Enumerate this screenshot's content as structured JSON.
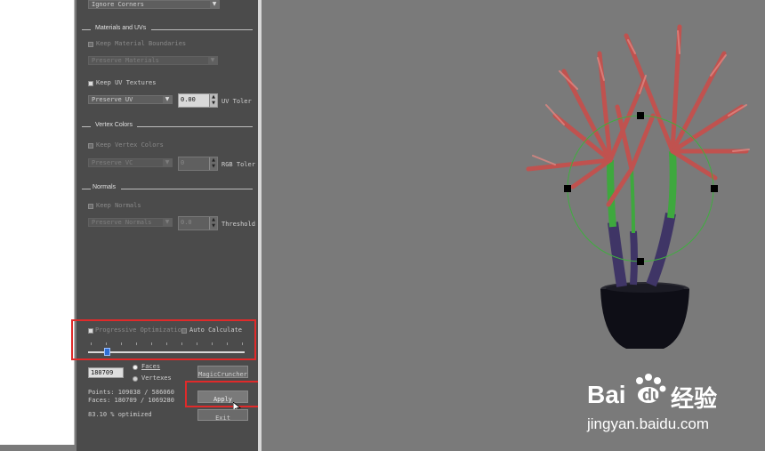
{
  "top": {
    "corners_dropdown": "Ignore Corners"
  },
  "materials": {
    "heading": "Materials and UVs",
    "keep_material_boundaries": "Keep Material Boundaries",
    "preserve_materials": "Preserve Materials",
    "keep_uv_textures": "Keep UV Textures",
    "preserve_uv": "Preserve UV",
    "uv_value": "0.00",
    "uv_tolerance_label": "UV Toler"
  },
  "vertex_colors": {
    "heading": "Vertex Colors",
    "keep_vertex_colors": "Keep Vertex Colors",
    "preserve_vc": "Preserve VC",
    "rgb_value": "0",
    "rgb_tolerance_label": "RGB Toler"
  },
  "normals": {
    "heading": "Normals",
    "keep_normals": "Keep Normals",
    "preserve_normals": "Preserve Normals",
    "threshold_value": "0.0",
    "threshold_label": "Threshold"
  },
  "optimization": {
    "progressive": "Progressive Optimization",
    "auto_calculate": "Auto Calculate",
    "slider_fraction": 0.12,
    "count_value": "180709",
    "faces_label": "Faces",
    "vertexes_label": "Vertexes",
    "magic_button": "MagicCruncher",
    "points_line": "Points: 109038 / 586060",
    "faces_line": "Faces: 180709 / 1069280",
    "optimized": "83.10 % optimized",
    "apply": "Apply",
    "exit": "Exit"
  },
  "watermark": {
    "brand": "Bai",
    "brand2": "du",
    "chinese": "经验",
    "url": "jingyan.baidu.com"
  },
  "colors": {
    "highlight_box": "#e02a2a",
    "slider_thumb": "#2f6fd6"
  }
}
